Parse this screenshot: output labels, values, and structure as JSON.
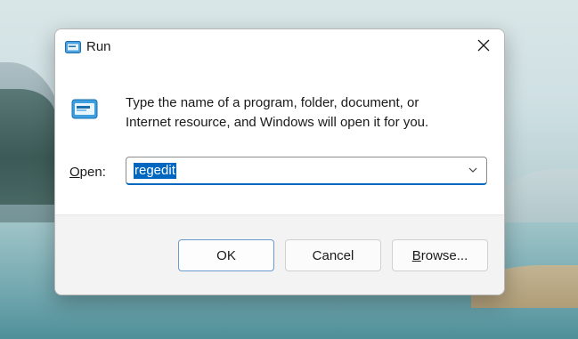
{
  "window": {
    "title": "Run",
    "icon": "run-icon",
    "close_icon": "close-icon"
  },
  "content": {
    "description_line1": "Type the name of a program, folder, document, or",
    "description_line2": "Internet resource, and Windows will open it for you.",
    "open_label_prefix": "O",
    "open_label_rest": "pen:",
    "open_value": "regedit",
    "dropdown_icon": "chevron-down-icon"
  },
  "buttons": {
    "ok": "OK",
    "cancel": "Cancel",
    "browse_accel": "B",
    "browse_rest": "rowse..."
  },
  "colors": {
    "accent": "#0067c0"
  }
}
